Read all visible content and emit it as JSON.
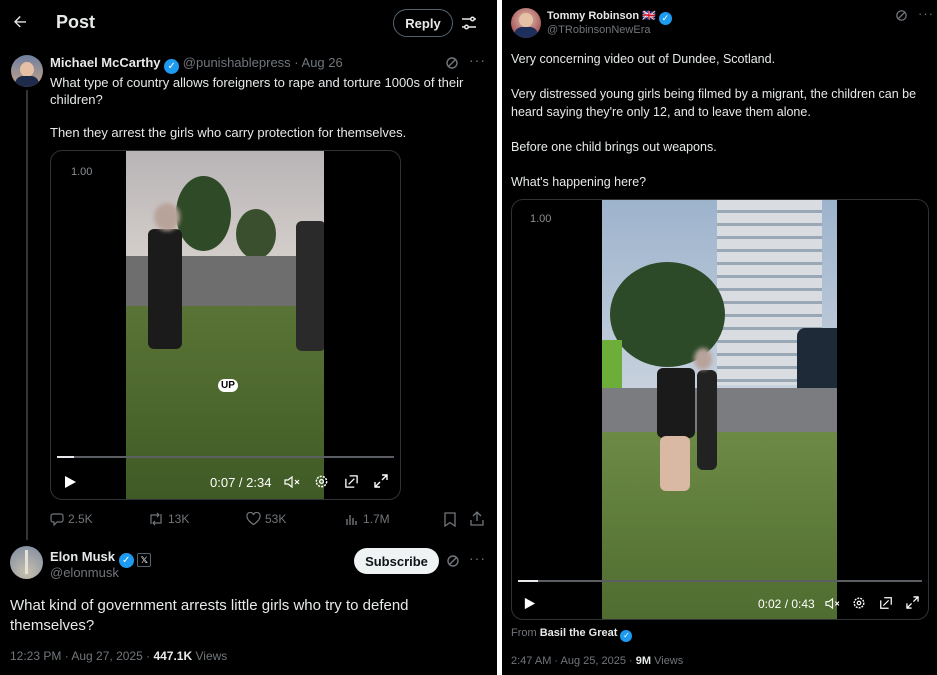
{
  "left": {
    "header": {
      "back_icon": "arrow-left-icon",
      "title": "Post",
      "reply_label": "Reply",
      "settings_icon": "sliders-icon"
    },
    "quoted": {
      "name": "Michael McCarthy",
      "handle": "@punishablepress",
      "date": "· Aug 26",
      "text1": "What type of country allows foreigners to rape and torture 1000s of their children?",
      "text2": "Then they arrest the girls who carry protection for themselves.",
      "video": {
        "speed": "1.00",
        "caption": "UP",
        "time": "0:07 / 2:34",
        "progress": 0.05
      },
      "actions": {
        "replies": "2.5K",
        "reposts": "13K",
        "likes": "53K",
        "views": "1.7M"
      }
    },
    "main": {
      "name": "Elon Musk",
      "handle": "@elonmusk",
      "affiliate_badge": "𝕏",
      "subscribe_label": "Subscribe",
      "text": "What kind of government arrests little girls who try to defend themselves?",
      "timestamp": "12:23 PM · Aug 27, 2025 ·",
      "views_count": "447.1K",
      "views_label": "Views"
    }
  },
  "right": {
    "author": {
      "name": "Tommy Robinson",
      "flag": "🇬🇧",
      "handle": "@TRobinsonNewEra"
    },
    "paragraphs": [
      "Very concerning video out of Dundee, Scotland.",
      "Very distressed young girls being filmed by a migrant, the children can be heard saying they're only 12, and to leave them alone.",
      "Before one child brings out weapons.",
      "What's happening here?"
    ],
    "video": {
      "speed": "1.00",
      "time": "0:02 / 0:43",
      "progress": 0.05
    },
    "from_label": "From",
    "from_name": "Basil the Great",
    "timestamp": "2:47 AM · Aug 25, 2025 ·",
    "views_count": "9M",
    "views_label": "Views"
  },
  "colors": {
    "accent": "#1d9bf0",
    "muted": "#71767b",
    "text": "#e7e9ea",
    "background": "#000000"
  }
}
